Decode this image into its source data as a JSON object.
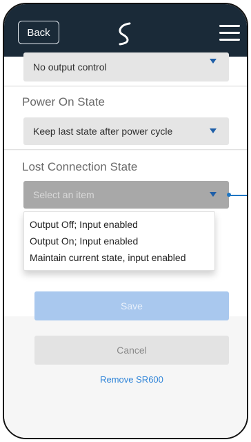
{
  "header": {
    "back_label": "Back",
    "logo_icon": "swirl-logo",
    "menu_icon": "hamburger-menu-icon"
  },
  "output_control": {
    "selected": "No output control"
  },
  "power_on_state": {
    "label": "Power On State",
    "selected": "Keep last state after power cycle"
  },
  "lost_connection_state": {
    "label": "Lost Connection State",
    "placeholder": "Select an item",
    "options": [
      "Output Off; Input enabled",
      "Output On; Input enabled",
      "Maintain current state, input enabled"
    ]
  },
  "actions": {
    "save_label": "Save",
    "cancel_label": "Cancel",
    "remove_label": "Remove SR600"
  },
  "colors": {
    "header_bg": "#1a2a38",
    "accent": "#1f5fa8",
    "link": "#2f84d8",
    "save_bg": "#a9c8ee"
  }
}
